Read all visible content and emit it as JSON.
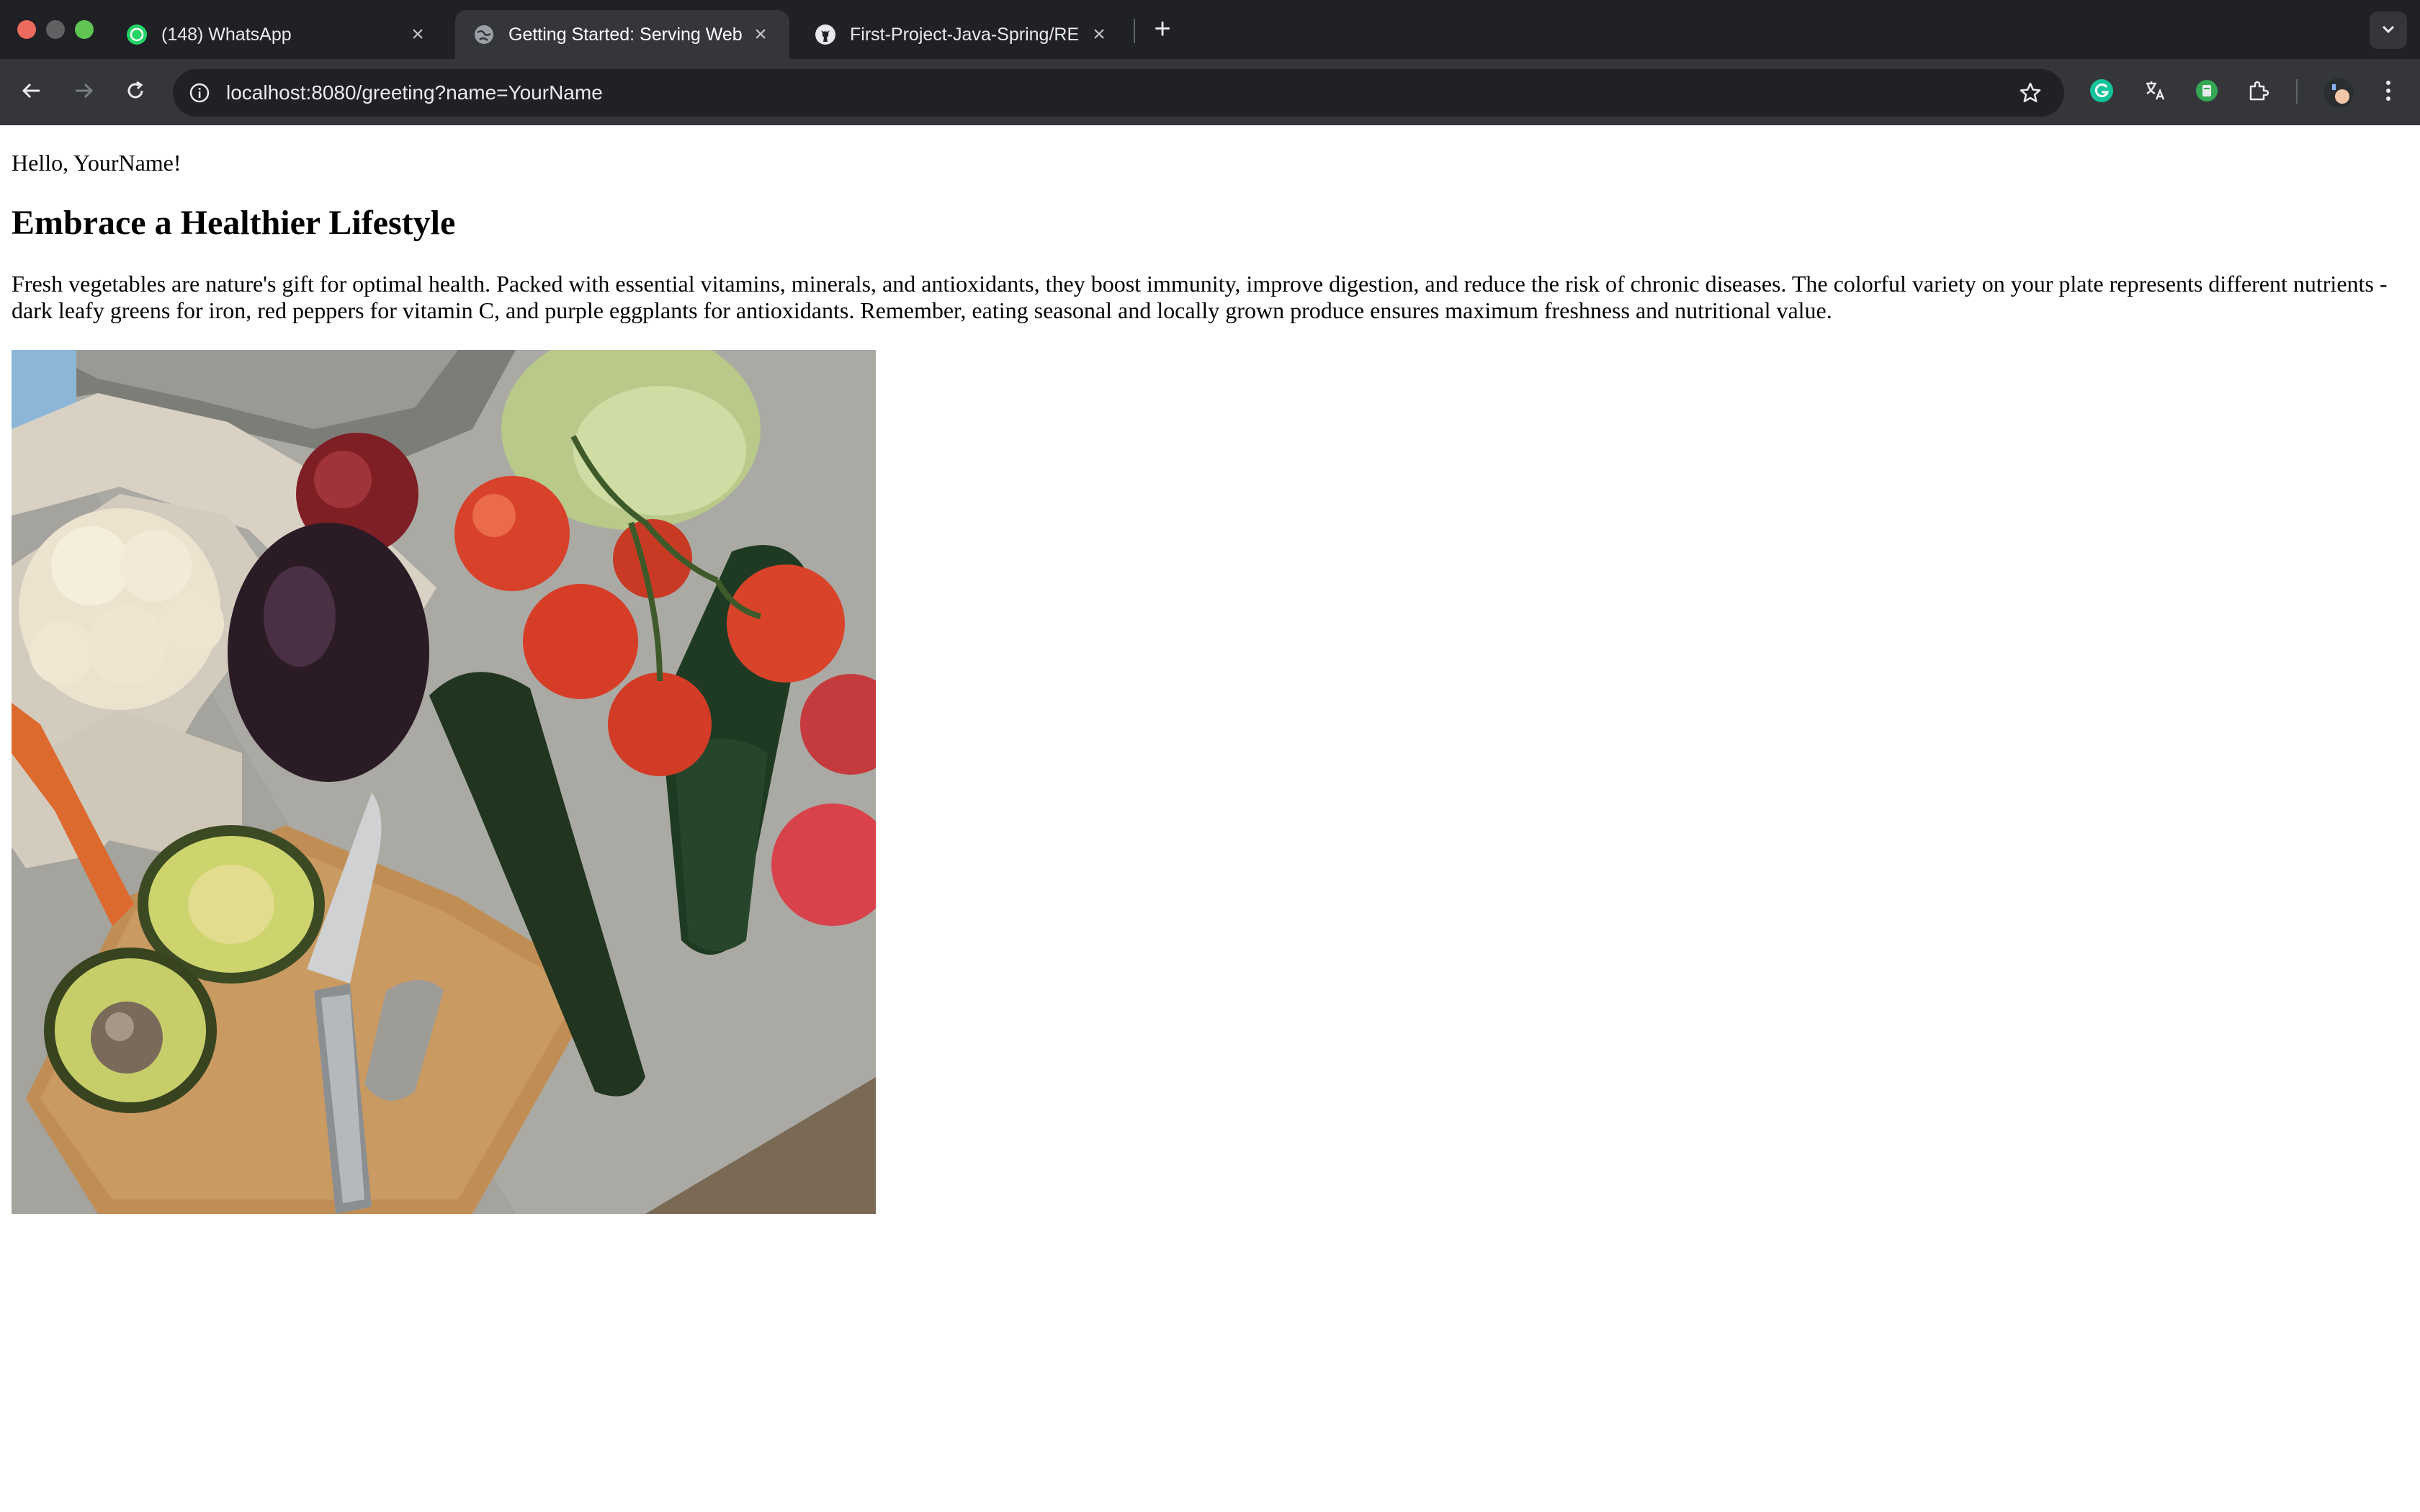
{
  "browser": {
    "tabs": [
      {
        "title": "(148) WhatsApp",
        "icon": "whatsapp-icon",
        "active": false
      },
      {
        "title": "Getting Started: Serving Web",
        "icon": "globe-icon",
        "active": true
      },
      {
        "title": "First-Project-Java-Spring/RE",
        "icon": "github-icon",
        "active": false
      }
    ],
    "url": "localhost:8080/greeting?name=YourName",
    "colors": {
      "chrome_bg": "#202124",
      "toolbar_bg": "#35363a",
      "omnibox_bg": "#202124"
    }
  },
  "page": {
    "greeting": "Hello, YourName!",
    "heading": "Embrace a Healthier Lifestyle",
    "paragraph": "Fresh vegetables are nature's gift for optimal health. Packed with essential vitamins, minerals, and antioxidants, they boost immunity, improve digestion, and reduce the risk of chronic diseases. The colorful variety on your plate represents different nutrients - dark leafy greens for iron, red peppers for vitamin C, and purple eggplants for antioxidants. Remember, eating seasonal and locally grown produce ensures maximum freshness and nutritional value."
  }
}
